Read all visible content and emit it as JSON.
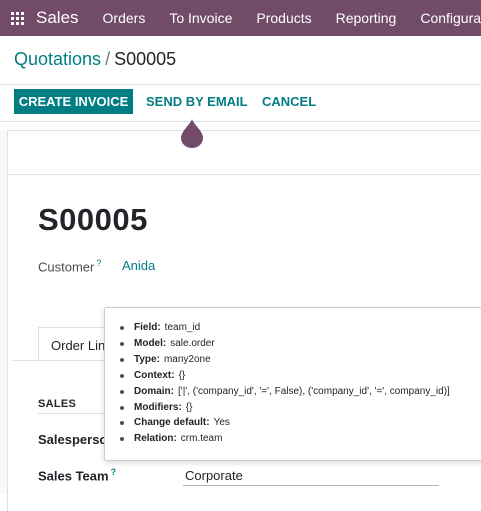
{
  "navbar": {
    "brand": "Sales",
    "menu": [
      "Orders",
      "To Invoice",
      "Products",
      "Reporting",
      "Configuration"
    ]
  },
  "breadcrumb": {
    "parent": "Quotations",
    "separator": "/",
    "current": "S00005"
  },
  "buttons": {
    "create_invoice": "CREATE INVOICE",
    "send_by_email": "SEND BY EMAIL",
    "cancel": "CANCEL"
  },
  "record": {
    "name": "S00005",
    "customer_label": "Customer",
    "help_mark": "?",
    "customer_value": "Anida"
  },
  "tabs": {
    "order_lines": "Order Lines"
  },
  "sales_section": {
    "heading": "SALES",
    "salesperson_label": "Salesperson",
    "sales_team_label": "Sales Team",
    "sales_team_value": "Corporate"
  },
  "tooltip": {
    "rows": [
      {
        "key": "Field:",
        "value": "team_id"
      },
      {
        "key": "Model:",
        "value": "sale.order"
      },
      {
        "key": "Type:",
        "value": "many2one"
      },
      {
        "key": "Context:",
        "value": "{}"
      },
      {
        "key": "Domain:",
        "value": "['|', ('company_id', '=', False), ('company_id', '=', company_id)]"
      },
      {
        "key": "Modifiers:",
        "value": "{}"
      },
      {
        "key": "Change default:",
        "value": "Yes"
      },
      {
        "key": "Relation:",
        "value": "crm.team"
      }
    ]
  },
  "colors": {
    "navbar": "#714b67",
    "primary": "#017e84"
  }
}
